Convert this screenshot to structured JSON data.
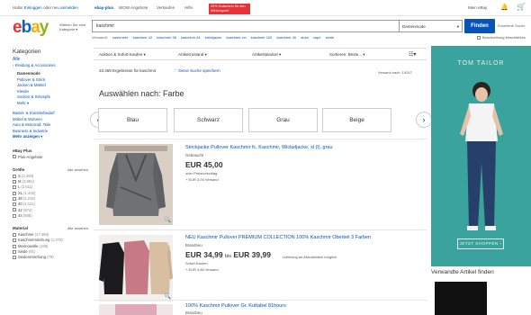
{
  "topbar": {
    "greeting_prefix": "Hallo!",
    "login": "Einloggen",
    "or": "oder neu",
    "register": "anmelden",
    "links": [
      "ebay-plus",
      "WOW Angebote",
      "Verkaufen",
      "Hilfe"
    ],
    "promo": "20% Gutschein für den Wintersport!",
    "my_ebay": "Mein eBay"
  },
  "header": {
    "logo_letters": [
      "e",
      "b",
      "a",
      "y"
    ],
    "category_select": "Wählen Sie eine Kategorie",
    "search_value": "kaschmir",
    "search_category": "Damenmode",
    "find_button": "Finden",
    "advanced": "Erweiterte Suche",
    "related_label": "Verwandt:",
    "related_terms": [
      "cashmere",
      "kaschmir 42",
      "kaschmir 38",
      "kaschmir 44",
      "strickjacke",
      "kaschmir xxl",
      "kaschmir 100",
      "kaschmir 40",
      "stola",
      "cape",
      "seide"
    ],
    "description_check": "Beschreibung einschließen"
  },
  "sidebar": {
    "title": "Kategorien",
    "all": "Alle",
    "top_category": "Kleidung & Accessoires",
    "sub_heading": "Damenmode",
    "sub_items": [
      "Pullover & Strick",
      "Jacken & Mäntel",
      "Kleider",
      "Socken & Strümpfe",
      "Mehr"
    ],
    "other_categories": [
      "Bastel- & Künstlerbedarf",
      "Möbel & Wohnen",
      "Auto & Motorrad: Teile",
      "Business & Industrie"
    ],
    "more": "Mehr anzeigen",
    "ebay_plus_title": "eBay Plus",
    "ebay_plus_option": "Plus-Angebote",
    "size_title": "Größe",
    "size_all": "Alle ansehen",
    "sizes": [
      {
        "label": "S",
        "count": "(2.269)"
      },
      {
        "label": "M",
        "count": "(2.991)"
      },
      {
        "label": "L",
        "count": "(2.611)"
      },
      {
        "label": "XL",
        "count": "(1.432)"
      },
      {
        "label": "38",
        "count": "(1.216)"
      },
      {
        "label": "40",
        "count": "(1.121)"
      },
      {
        "label": "42",
        "count": "(974)"
      },
      {
        "label": "44",
        "count": "(805)"
      }
    ],
    "material_title": "Material",
    "material_all": "Alle ansehen",
    "materials": [
      {
        "label": "Kaschmir",
        "count": "(17.458)"
      },
      {
        "label": "Kaschmirmischung",
        "count": "(1.479)"
      },
      {
        "label": "Merinowolle",
        "count": "(169)"
      },
      {
        "label": "Seide",
        "count": "(91)"
      },
      {
        "label": "Seidenmischung",
        "count": "(79)"
      }
    ]
  },
  "filters": {
    "items": [
      "Auktion & Sofort-Kaufen",
      "Artikelzustand",
      "Artikelstandort",
      "Sortieren: Beste..."
    ],
    "results": "33.469 Ergebnisse für kaschmir",
    "save_search": "Diese Suche speichern",
    "ship_to": "Versand nach: 10247"
  },
  "colors": {
    "title": "Auswählen nach: Farbe",
    "options": [
      "Blau",
      "Schwarz",
      "Grau",
      "Beige"
    ],
    "accent": "#0654ba",
    "ad_bg": "#3aa39d"
  },
  "listings": [
    {
      "title_prefix": "Strickjacke Pullover Kaschmir fc, Kaschmir, Wickeljacke, xl (l), grau",
      "condition": "Gebraucht",
      "price": "EUR 45,00",
      "note": "oder Preisvorschlag",
      "shipping": "+ EUR 3,00 Versand"
    },
    {
      "title_prefix": "NEU Kaschmir Pullover PREMIUM COLLECTION 100% Kaschmir Oberteil 3 Farben",
      "condition": "Brandneu",
      "price_from": "EUR 34,99",
      "price_to_word": "bis",
      "price_to": "EUR 39,99",
      "note": "Sofort-Kaufen",
      "shipping": "+ EUR 4,80 Versand",
      "delivery": "Lieferung an Abholstation möglich"
    },
    {
      "title_prefix": "100% Kaschmir Pullover Gr. Kuttabel 81hours",
      "condition": "Brandneu"
    }
  ],
  "ad": {
    "brand": "TOM TAILOR",
    "cta": "JETZT SHOPPEN ›"
  },
  "related_items_title": "Verwandte Artikel finden"
}
